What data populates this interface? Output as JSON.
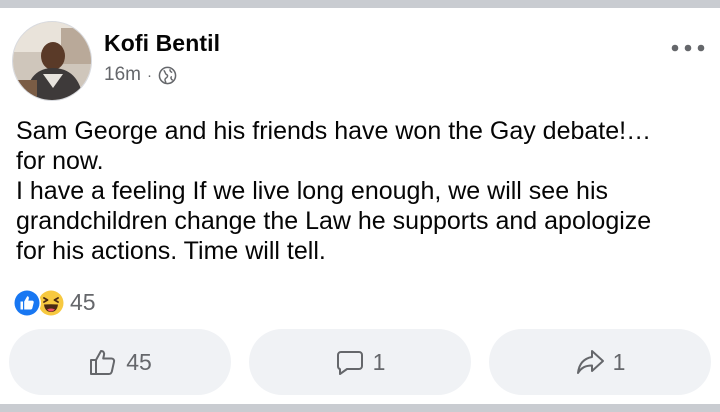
{
  "post": {
    "author": "Kofi Bentil",
    "time": "16m",
    "separator": "·",
    "privacy_icon": "globe-icon",
    "text_lines": [
      "Sam George and his friends have won the Gay debate!…",
      "for now.",
      "I have a feeling If we live long enough, we will see his",
      "grandchildren change the Law he supports and apologize",
      "for his actions. Time will tell."
    ]
  },
  "reactions": {
    "icons": [
      "like-icon",
      "haha-icon"
    ],
    "count": "45"
  },
  "actions": {
    "like": {
      "icon": "thumbs-up-icon",
      "count": "45"
    },
    "comment": {
      "icon": "comment-icon",
      "count": "1"
    },
    "share": {
      "icon": "share-icon",
      "count": "1"
    }
  },
  "colors": {
    "text": "#050505",
    "secondary": "#65676b",
    "like_blue": "#1877f2",
    "haha_yellow": "#f7c940",
    "button_bg": "#f0f2f5",
    "divider": "#c9ccd1"
  }
}
